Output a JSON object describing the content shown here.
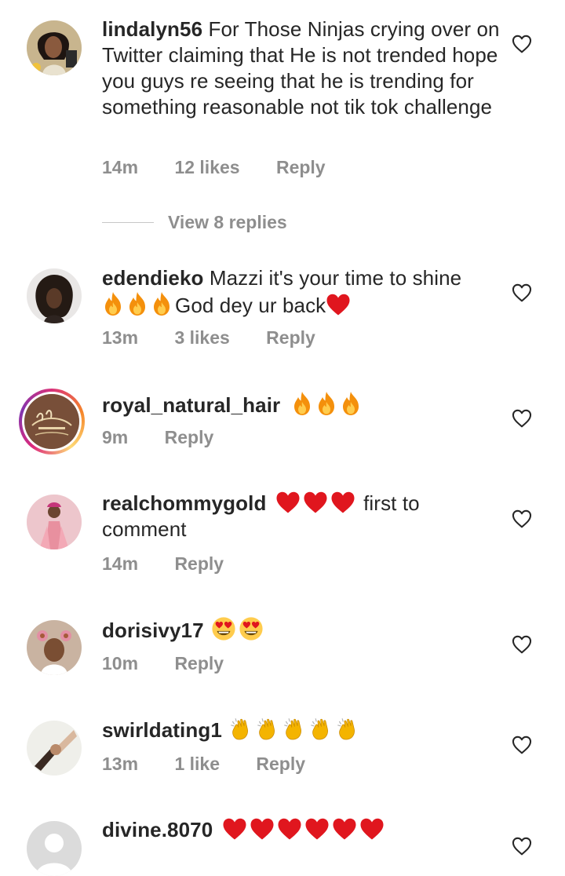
{
  "comments": [
    {
      "username": "lindalyn56",
      "text": "For Those Ninjas crying over on Twitter claiming that He is not trended hope you guys re seeing that he is trending for something reasonable not tik tok challenge",
      "time": "14m",
      "likes": "12 likes",
      "reply": "Reply",
      "view_replies": "View 8 replies"
    },
    {
      "username": "edendieko",
      "text_before": "Mazzi it's your time to shine",
      "text_after": "God dey ur back",
      "time": "13m",
      "likes": "3 likes",
      "reply": "Reply"
    },
    {
      "username": "royal_natural_hair",
      "time": "9m",
      "reply": "Reply"
    },
    {
      "username": "realchommygold",
      "text": "first to comment",
      "time": "14m",
      "reply": "Reply"
    },
    {
      "username": "dorisivy17",
      "time": "10m",
      "reply": "Reply"
    },
    {
      "username": "swirldating1",
      "time": "13m",
      "likes": "1 like",
      "reply": "Reply"
    },
    {
      "username": "divine.8070"
    }
  ],
  "icons": {
    "like": "heart-outline-icon",
    "fire": "fire-emoji",
    "heart": "red-heart-emoji",
    "heart_eyes": "heart-eyes-emoji",
    "clap": "clapping-hands-emoji"
  },
  "colors": {
    "text": "#262626",
    "meta": "#8e8e8e",
    "emoji_heart": "#e0161e",
    "story_ring": "#dd2a7b"
  }
}
